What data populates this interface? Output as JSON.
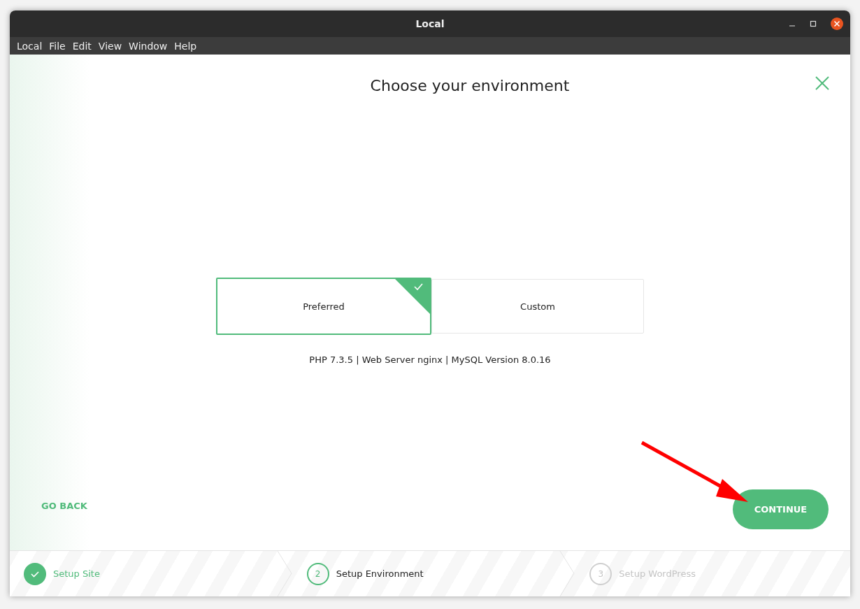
{
  "window": {
    "title": "Local"
  },
  "menu": [
    "Local",
    "File",
    "Edit",
    "View",
    "Window",
    "Help"
  ],
  "dialog": {
    "title": "Choose your environment",
    "options": [
      {
        "label": "Preferred",
        "selected": true
      },
      {
        "label": "Custom",
        "selected": false
      }
    ],
    "description": "PHP 7.3.5 | Web Server nginx | MySQL Version 8.0.16",
    "back_button": "GO BACK",
    "continue_button": "CONTINUE"
  },
  "steps": [
    {
      "label": "Setup Site",
      "kind": "done"
    },
    {
      "number": "2",
      "label": "Setup Environment",
      "kind": "current"
    },
    {
      "number": "3",
      "label": "Setup WordPress",
      "kind": "pending"
    }
  ]
}
